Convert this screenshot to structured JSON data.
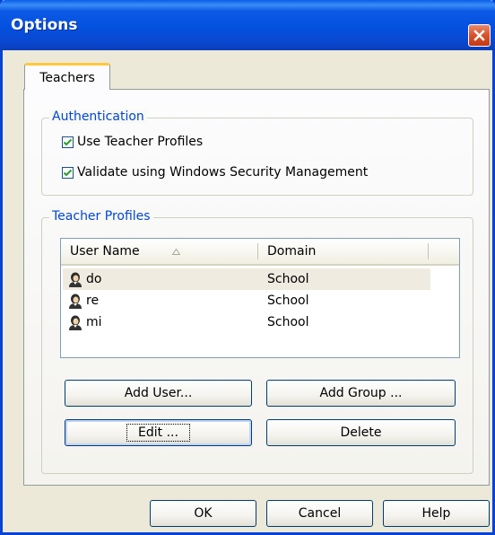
{
  "window": {
    "title": "Options"
  },
  "tabs": [
    {
      "label": "Teachers"
    }
  ],
  "authentication": {
    "legend": "Authentication",
    "options": [
      {
        "label": "Use Teacher Profiles",
        "checked": true
      },
      {
        "label": "Validate using Windows Security Management",
        "checked": true
      }
    ]
  },
  "profiles": {
    "legend": "Teacher Profiles",
    "columns": [
      {
        "label": "User Name",
        "sort": "ascending"
      },
      {
        "label": "Domain"
      }
    ],
    "rows": [
      {
        "user": "do",
        "domain": "School",
        "selected": true
      },
      {
        "user": "re",
        "domain": "School",
        "selected": false
      },
      {
        "user": "mi",
        "domain": "School",
        "selected": false
      }
    ],
    "buttons": {
      "add_user": "Add User...",
      "add_group": "Add Group ...",
      "edit": "Edit ...",
      "delete": "Delete"
    }
  },
  "footer": {
    "ok": "OK",
    "cancel": "Cancel",
    "help": "Help"
  },
  "icons": {
    "close": "close-icon",
    "user": "user-icon",
    "check": "checkmark-icon",
    "sort": "sort-ascending-icon"
  },
  "colors": {
    "titlebar": "#0451df",
    "close_button": "#d4522c",
    "group_legend": "#0046d5",
    "tab_highlight": "#ffc83c"
  }
}
